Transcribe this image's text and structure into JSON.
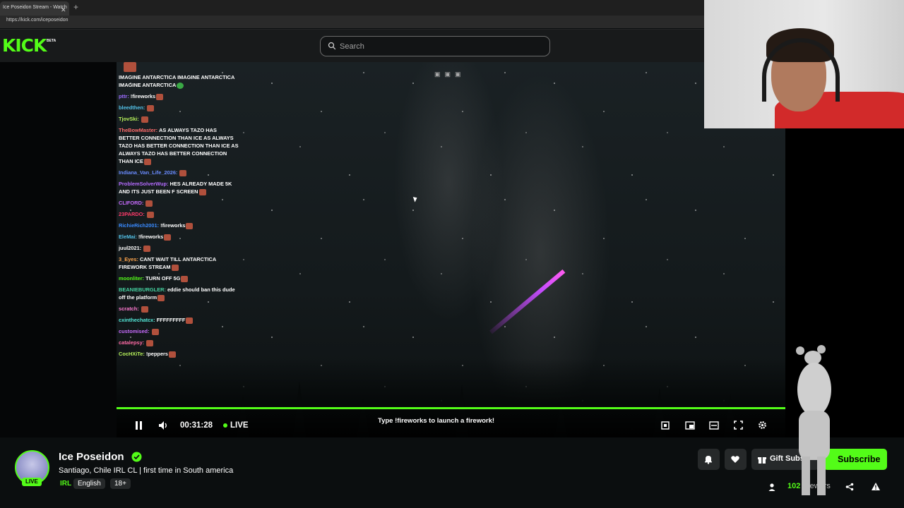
{
  "browser": {
    "tab_title": "Ice Poseidon Stream - Watch",
    "url": "https://kick.com/iceposeidon"
  },
  "header": {
    "logo": "KICK",
    "logo_badge": "BETA",
    "search_placeholder": "Search"
  },
  "video": {
    "firework_prompt": "Type !fireworks to launch a firework!",
    "elapsed": "00:31:28",
    "live_label": "LIVE"
  },
  "chat": [
    {
      "user": "",
      "user_color": "#ffffff",
      "text": "IMAGINE ANTARCTICA  IMAGINE ANTARCTICA  IMAGINE ANTARCTICA"
    },
    {
      "user": "pttr:",
      "user_color": "#9b6cff",
      "text": "!fireworks"
    },
    {
      "user": "bleedthen:",
      "user_color": "#53c2e8",
      "text": ""
    },
    {
      "user": "TjovSki:",
      "user_color": "#b5f05a",
      "text": ""
    },
    {
      "user": "TheBowMaster:",
      "user_color": "#ff6b6b",
      "text": "AS ALWAYS TAZO HAS BETTER CONNECTION THAN ICE  AS ALWAYS TAZO HAS BETTER CONNECTION THAN ICE  AS ALWAYS TAZO HAS BETTER CONNECTION THAN ICE"
    },
    {
      "user": "Indiana_Van_Life_2026:",
      "user_color": "#6a8cff",
      "text": ""
    },
    {
      "user": "ProblemSolverWup:",
      "user_color": "#b46bff",
      "text": "HES ALREADY MADE 5K AND ITS JUST BEEN F SCREEN"
    },
    {
      "user": "CLIFORD:",
      "user_color": "#c86bff",
      "text": ""
    },
    {
      "user": "23PARDO:",
      "user_color": "#ff3a6a",
      "text": ""
    },
    {
      "user": "RichieRich2001:",
      "user_color": "#3a8bff",
      "text": "!fireworks"
    },
    {
      "user": "EleMai:",
      "user_color": "#53c2e8",
      "text": "!fireworks"
    },
    {
      "user": "juul2021:",
      "user_color": "#ffffff",
      "text": ""
    },
    {
      "user": "3_Eyes:",
      "user_color": "#ffa64d",
      "text": "CANT WAIT TILL ANTARCTICA FIREWORK STREAM"
    },
    {
      "user": "moonliter:",
      "user_color": "#53fc18",
      "text": "TURN OFF 5G"
    },
    {
      "user": "BEANIEBURGLER:",
      "user_color": "#45d1a0",
      "text": "eddie should ban this dude off the platform"
    },
    {
      "user": "scratch:",
      "user_color": "#ff7ad1",
      "text": ""
    },
    {
      "user": "cxinthechatcx:",
      "user_color": "#53e8d8",
      "text": "FFFFFFFFF"
    },
    {
      "user": "customised:",
      "user_color": "#c86bff",
      "text": ""
    },
    {
      "user": "catalepsy:",
      "user_color": "#ff6ba6",
      "text": ""
    },
    {
      "user": "CocHXiTe:",
      "user_color": "#b5f05a",
      "text": "!peppers"
    }
  ],
  "channel": {
    "name": "Ice Poseidon",
    "title": "Santiago, Chile IRL CL | first time in South america",
    "live_badge": "LIVE",
    "tags": [
      "IRL",
      "English",
      "18+"
    ],
    "viewers": "102",
    "viewers_label": "Viewers",
    "gift_label": "Gift Subs",
    "subscribe_label": "Subscribe"
  },
  "colors": {
    "accent": "#53fc18",
    "header_bg": "#181a1b",
    "page_bg": "#0b0e0f"
  }
}
